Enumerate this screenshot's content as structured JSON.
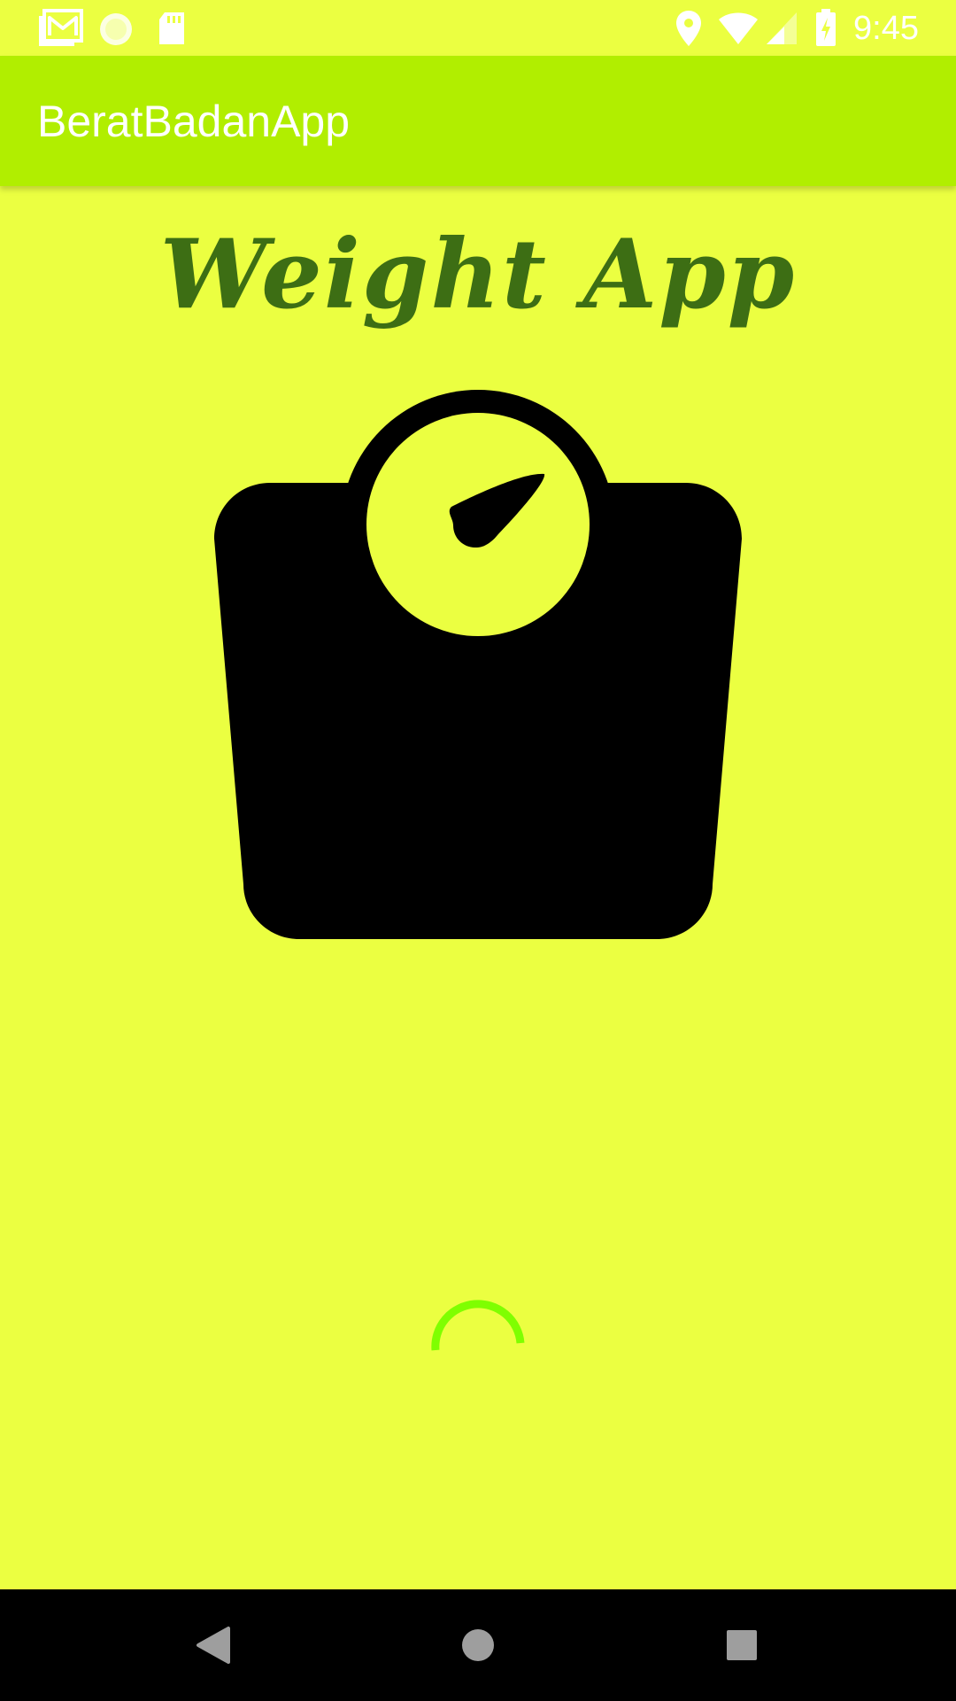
{
  "status_bar": {
    "time": "9:45",
    "icons_left": [
      "gmail-icon",
      "circle-notification-icon",
      "sd-card-icon"
    ],
    "icons_right": [
      "location-icon",
      "wifi-icon",
      "signal-icon",
      "battery-charging-icon"
    ]
  },
  "app_bar": {
    "title": "BeratBadanApp",
    "color": "#b1ee00"
  },
  "main": {
    "heading": "Weight App",
    "heading_color": "#3d6e14",
    "background": "#ebff41",
    "illustration": "weighing-scale-icon",
    "spinner_color": "#7fff00"
  },
  "nav_bar": {
    "buttons": [
      "back-icon",
      "home-icon",
      "recents-icon"
    ]
  }
}
